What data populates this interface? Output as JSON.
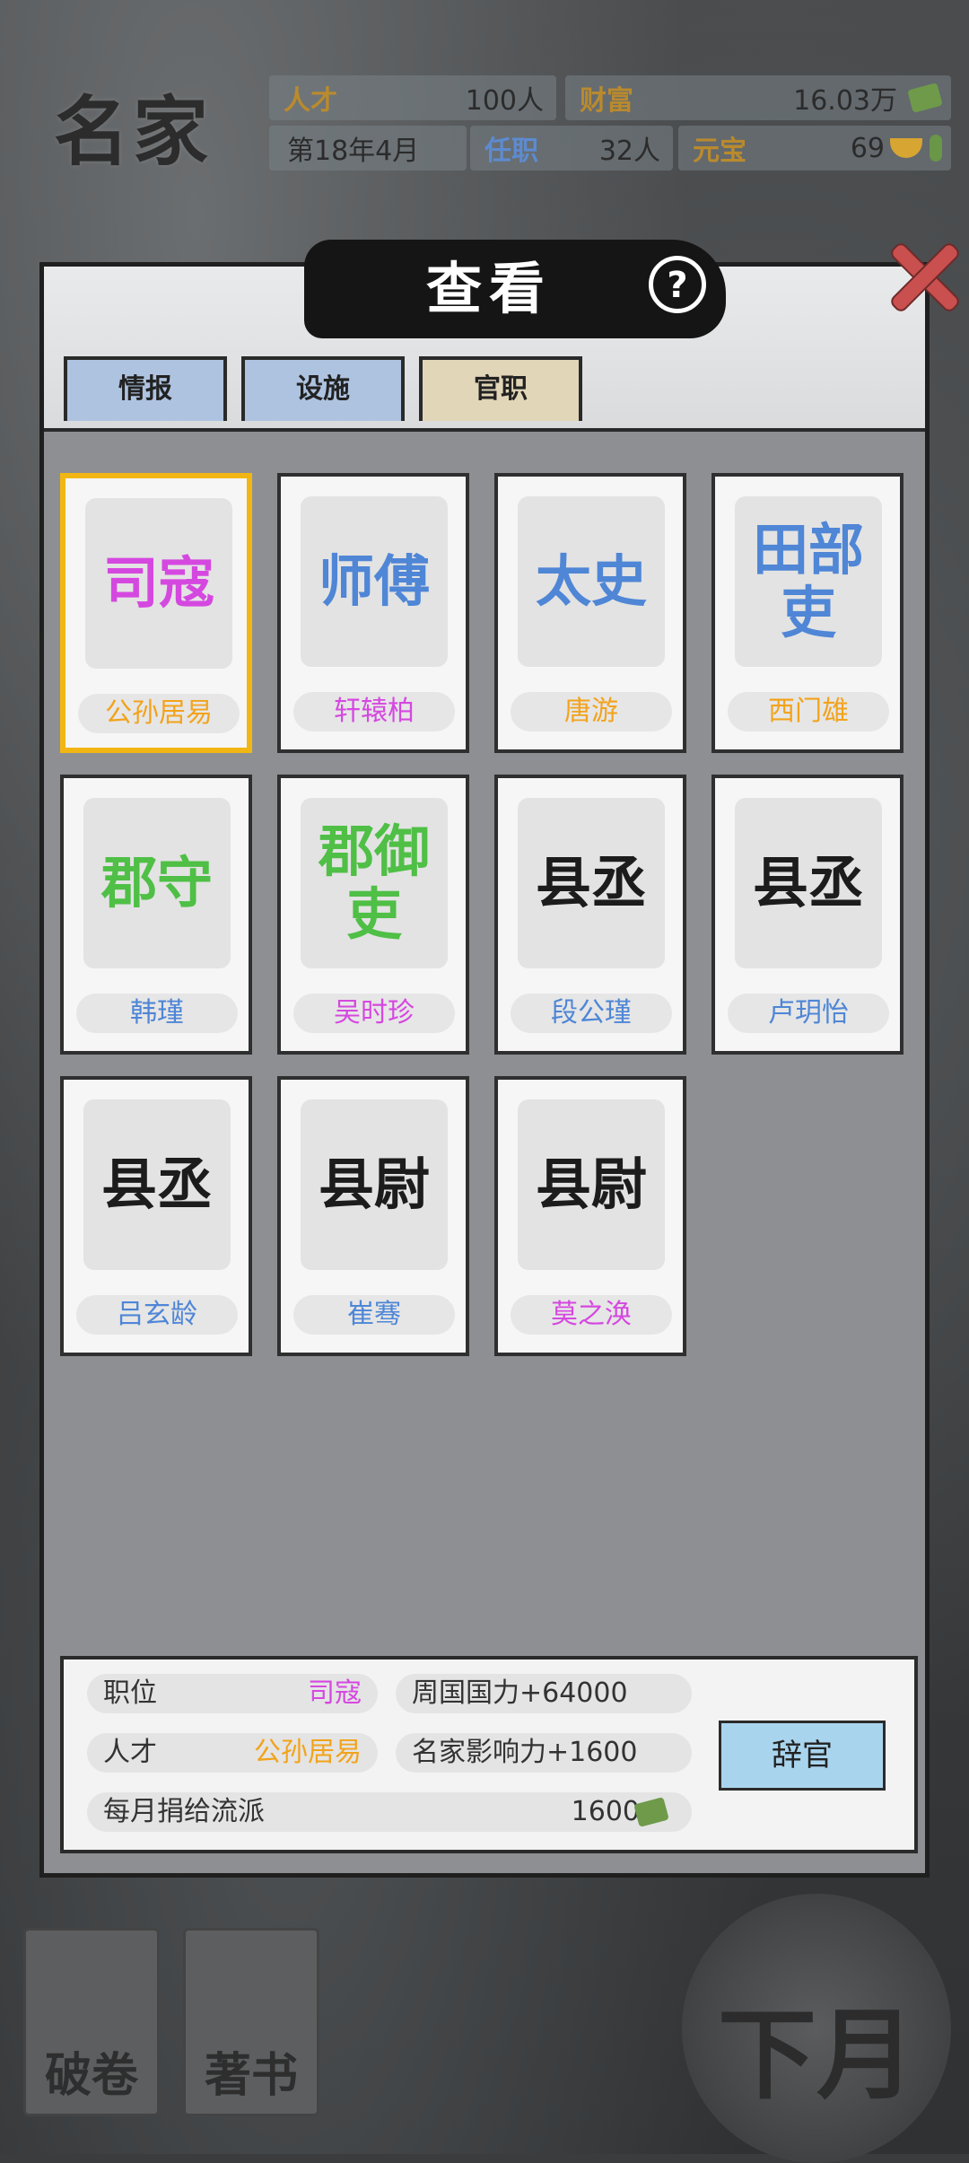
{
  "header": {
    "game_name": "名家",
    "stats": {
      "talent_label": "人才",
      "talent_value": "100人",
      "wealth_label": "财富",
      "wealth_value": "16.03万",
      "date": "第18年4月",
      "office_label": "任职",
      "office_value": "32人",
      "yuanbao_label": "元宝",
      "yuanbao_value": "69"
    }
  },
  "panel": {
    "title": "查看",
    "help_icon": "?",
    "tabs": [
      {
        "label": "情报",
        "active": false
      },
      {
        "label": "设施",
        "active": false
      },
      {
        "label": "官职",
        "active": true
      }
    ]
  },
  "cards": [
    {
      "title": "司寇",
      "name": "公孙居易",
      "title_color": "#d548e0",
      "name_color": "#f2a31c",
      "selected": true
    },
    {
      "title": "师傅",
      "name": "轩辕柏",
      "title_color": "#4f86d6",
      "name_color": "#d548e0",
      "selected": false
    },
    {
      "title": "太史",
      "name": "唐游",
      "title_color": "#4f86d6",
      "name_color": "#f2a31c",
      "selected": false
    },
    {
      "title": "田部吏",
      "name": "西门雄",
      "title_color": "#4f86d6",
      "name_color": "#f2a31c",
      "selected": false
    },
    {
      "title": "郡守",
      "name": "韩瑾",
      "title_color": "#4fbf46",
      "name_color": "#4f86d6",
      "selected": false
    },
    {
      "title": "郡御吏",
      "name": "吴时珍",
      "title_color": "#4fbf46",
      "name_color": "#d548e0",
      "selected": false
    },
    {
      "title": "县丞",
      "name": "段公瑾",
      "title_color": "#1c1c1c",
      "name_color": "#4f86d6",
      "selected": false
    },
    {
      "title": "县丞",
      "name": "卢玥怡",
      "title_color": "#1c1c1c",
      "name_color": "#4f86d6",
      "selected": false
    },
    {
      "title": "县丞",
      "name": "吕玄龄",
      "title_color": "#1c1c1c",
      "name_color": "#4f86d6",
      "selected": false
    },
    {
      "title": "县尉",
      "name": "崔骞",
      "title_color": "#1c1c1c",
      "name_color": "#4f86d6",
      "selected": false
    },
    {
      "title": "县尉",
      "name": "莫之涣",
      "title_color": "#1c1c1c",
      "name_color": "#d548e0",
      "selected": false
    }
  ],
  "info": {
    "position_label": "职位",
    "position_value": "司寇",
    "talent_label": "人才",
    "talent_value": "公孙居易",
    "bonus_1": "周国国力+64000",
    "bonus_2": "名家影响力+1600",
    "donation_label": "每月捐给流派",
    "donation_value": "1600",
    "resign_button": "辞官"
  },
  "bottom": {
    "btn_1": "破卷",
    "btn_2": "著书",
    "next_month": "下月"
  },
  "colors": {
    "magenta": "#d548e0",
    "orange": "#f2a31c",
    "blue": "#4f86d6",
    "green": "#4fbf46",
    "selected_border": "#f2b614"
  }
}
